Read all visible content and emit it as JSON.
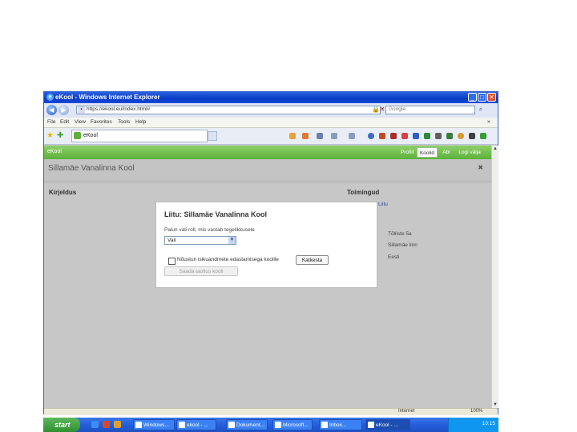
{
  "window": {
    "title": "eKool - Windows Internet Explorer",
    "minimize": "_",
    "maximize": "□",
    "close": "✕"
  },
  "browser": {
    "back": "◀",
    "forward": "▶",
    "address": "https://ekool.eu/index.html#",
    "search_placeholder": "Google",
    "menu_items": [
      "File",
      "Edit",
      "View",
      "Favorites",
      "Tools",
      "Help"
    ],
    "tab_label": "eKool",
    "more": "»"
  },
  "app": {
    "name": "eKool",
    "tabs": [
      {
        "label": "Profiil",
        "active": false
      },
      {
        "label": "Koolid",
        "active": true
      },
      {
        "label": "Abi",
        "active": false
      },
      {
        "label": "Logi välja",
        "active": false
      }
    ]
  },
  "page": {
    "school_name": "Sillamäe Vanalinna Kool",
    "close": "✖",
    "description_heading": "Kirjeldus",
    "actions_heading": "Toimingud",
    "actions_link": "Liitu",
    "contact_lines": [
      "Tõlliste 5a",
      "Sillamäe linn",
      "Eesti"
    ]
  },
  "dialog": {
    "title": "Liitu: Sillamäe Vanalinna Kool",
    "select_label": "Palun vali roll, mis vastab tegelikkusele",
    "select_value": "Vali",
    "checkbox_label": "Nõustun isikuandmete edastamisega koolile",
    "checkbox_checked": false,
    "cancel_label": "Katkesta",
    "send_label": "Saada taotlus kooli"
  },
  "statusbar": {
    "zone": "Internet",
    "zoom": "100%"
  },
  "taskbar": {
    "start": "start",
    "tasks": [
      {
        "label": "Windows...",
        "active": false
      },
      {
        "label": "ekool - ...",
        "active": false
      },
      {
        "label": "Dokument...",
        "active": false
      },
      {
        "label": "Microsoft...",
        "active": false
      },
      {
        "label": "Inbox...",
        "active": false
      },
      {
        "label": "eKool - ...",
        "active": true
      }
    ],
    "clock": "10:15"
  },
  "colors": {
    "titlebar": "#0a3cc8",
    "appbar": "#5bb13a",
    "content_bg": "#c7c7c7",
    "taskbar": "#245edb",
    "start": "#2f8f2f"
  }
}
